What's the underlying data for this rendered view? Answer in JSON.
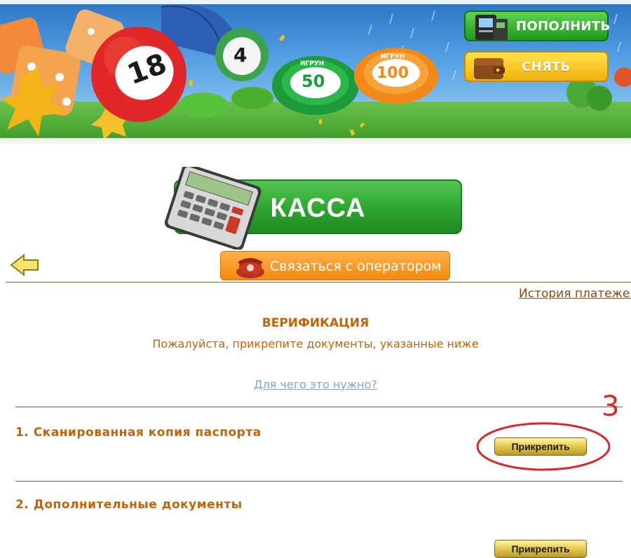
{
  "banner": {
    "ball_numbers": [
      "18",
      "4"
    ],
    "chip_50": {
      "value": "50",
      "text": "ИГРУН"
    },
    "chip_100": {
      "value": "100",
      "text": "ИГРУН"
    },
    "deposit_label": "ПОПОЛНИТЬ",
    "withdraw_label": "СНЯТЬ"
  },
  "cashier": {
    "title": "КАССА",
    "contact_operator": "Связаться с оператором",
    "payment_history": "История платежей"
  },
  "verification": {
    "title": "ВЕРИФИКАЦИЯ",
    "subtitle": "Пожалуйста, прикрепите документы, указанные ниже",
    "why_link": "Для чего это нужно?"
  },
  "documents": [
    {
      "label": "1. Сканированная копия паспорта",
      "button": "Прикрепить"
    },
    {
      "label": "2. Дополнительные документы",
      "button": "Прикрепить"
    }
  ],
  "annotation": {
    "number": "3",
    "color": "#d42a2a"
  },
  "colors": {
    "accent_orange": "#c0640a",
    "green": "#2ea42f",
    "link_blue": "#7fa6c8"
  }
}
